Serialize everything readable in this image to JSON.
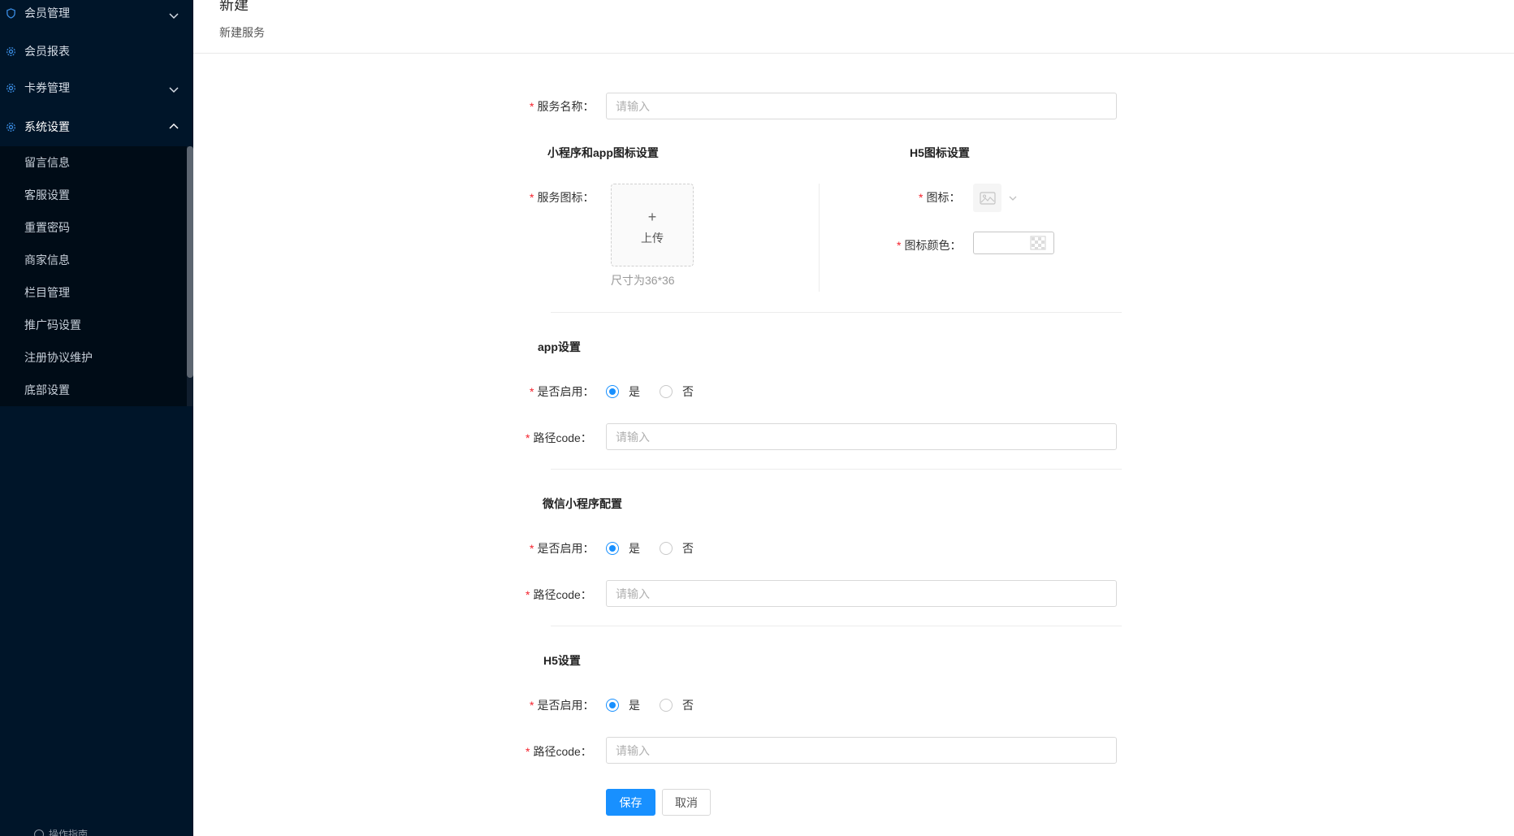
{
  "sidebar": {
    "menu": [
      {
        "label": "会员管理",
        "icon": "shield-icon",
        "expanded": false
      },
      {
        "label": "会员报表",
        "icon": "gear-icon"
      },
      {
        "label": "卡券管理",
        "icon": "gear-icon",
        "expanded": false
      },
      {
        "label": "系统设置",
        "icon": "gear-icon",
        "expanded": true
      }
    ],
    "submenu": [
      "留言信息",
      "客服设置",
      "重置密码",
      "商家信息",
      "栏目管理",
      "推广码设置",
      "注册协议维护",
      "底部设置"
    ],
    "footer": "操作指南"
  },
  "header": {
    "title": "新建",
    "subtitle": "新建服务"
  },
  "form": {
    "service_name": {
      "label": "服务名称：",
      "placeholder": "请输入"
    },
    "mini_icon_section": "小程序和app图标设置",
    "h5_icon_section": "H5图标设置",
    "service_icon": {
      "label": "服务图标：",
      "upload_plus": "+",
      "upload_text": "上传",
      "hint": "尺寸为36*36"
    },
    "h5_icon": {
      "label": "图标："
    },
    "h5_icon_color": {
      "label": "图标颜色："
    },
    "sections": [
      {
        "title": "app设置",
        "enable_label": "是否启用：",
        "yes": "是",
        "no": "否",
        "selected": "是",
        "path_label": "路径code：",
        "path_placeholder": "请输入"
      },
      {
        "title": "微信小程序配置",
        "enable_label": "是否启用：",
        "yes": "是",
        "no": "否",
        "selected": "是",
        "path_label": "路径code：",
        "path_placeholder": "请输入"
      },
      {
        "title": "H5设置",
        "enable_label": "是否启用：",
        "yes": "是",
        "no": "否",
        "selected": "是",
        "path_label": "路径code：",
        "path_placeholder": "请输入"
      }
    ],
    "required_mark": "*",
    "save_label": "保存",
    "cancel_label": "取消"
  },
  "colors": {
    "sidebar_bg": "#001529",
    "submenu_bg": "#000c17",
    "primary": "#1890ff",
    "required": "#f5222d"
  }
}
